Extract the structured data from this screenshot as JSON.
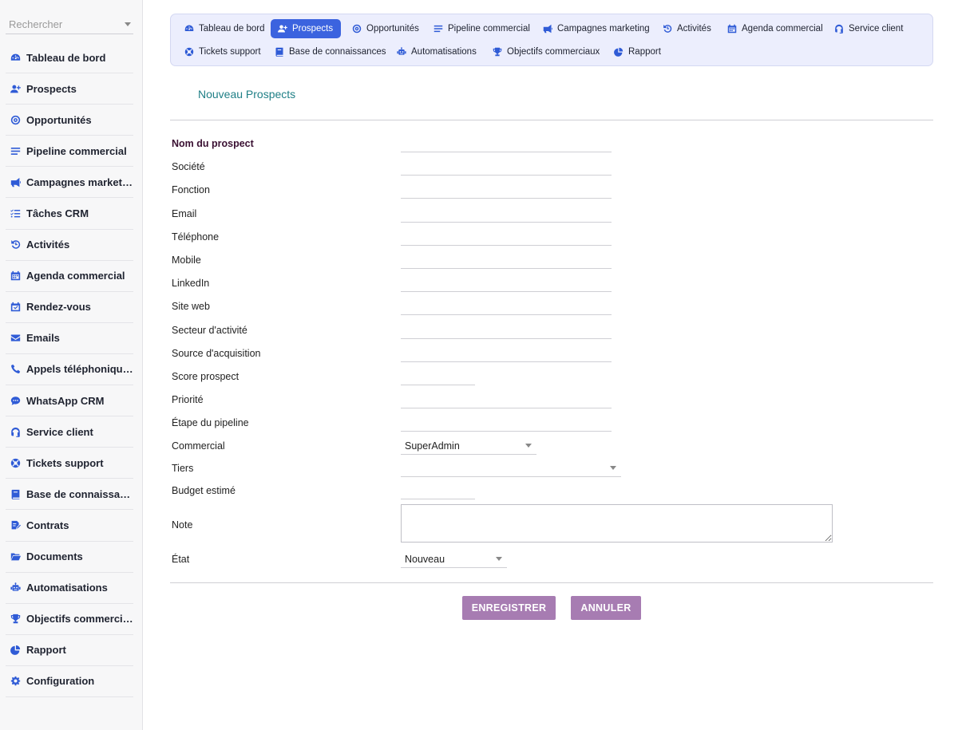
{
  "search": {
    "placeholder": "Rechercher"
  },
  "sidebar": {
    "items": [
      {
        "label": "Tableau de bord",
        "icon": "dashboard-icon"
      },
      {
        "label": "Prospects",
        "icon": "user-plus-icon"
      },
      {
        "label": "Opportunités",
        "icon": "target-icon"
      },
      {
        "label": "Pipeline commercial",
        "icon": "bars-icon"
      },
      {
        "label": "Campagnes marketing",
        "icon": "megaphone-icon"
      },
      {
        "label": "Tâches CRM",
        "icon": "tasks-icon"
      },
      {
        "label": "Activités",
        "icon": "history-icon"
      },
      {
        "label": "Agenda commercial",
        "icon": "calendar-icon"
      },
      {
        "label": "Rendez-vous",
        "icon": "calendar-check-icon"
      },
      {
        "label": "Emails",
        "icon": "envelope-icon"
      },
      {
        "label": "Appels téléphoniques",
        "icon": "phone-icon"
      },
      {
        "label": "WhatsApp CRM",
        "icon": "chat-icon"
      },
      {
        "label": "Service client",
        "icon": "headset-icon"
      },
      {
        "label": "Tickets support",
        "icon": "lifering-icon"
      },
      {
        "label": "Base de connaissances",
        "icon": "book-icon"
      },
      {
        "label": "Contrats",
        "icon": "contract-icon"
      },
      {
        "label": "Documents",
        "icon": "folder-icon"
      },
      {
        "label": "Automatisations",
        "icon": "robot-icon"
      },
      {
        "label": "Objectifs commerciaux",
        "icon": "trophy-icon"
      },
      {
        "label": "Rapport",
        "icon": "pie-icon"
      },
      {
        "label": "Configuration",
        "icon": "gear-icon"
      }
    ]
  },
  "topnav": {
    "tabs": [
      {
        "label": "Tableau de bord",
        "icon": "dashboard-icon",
        "active": false
      },
      {
        "label": "Prospects",
        "icon": "user-plus-icon",
        "active": true
      },
      {
        "label": "Opportunités",
        "icon": "target-icon",
        "active": false
      },
      {
        "label": "Pipeline commercial",
        "icon": "bars-icon",
        "active": false
      },
      {
        "label": "Campagnes marketing",
        "icon": "megaphone-icon",
        "active": false
      },
      {
        "label": "Activités",
        "icon": "history-icon",
        "active": false
      },
      {
        "label": "Agenda commercial",
        "icon": "calendar-icon",
        "active": false
      },
      {
        "label": "Service client",
        "icon": "headset-icon",
        "active": false
      },
      {
        "label": "Tickets support",
        "icon": "lifering-icon",
        "active": false
      },
      {
        "label": "Base de connaissances",
        "icon": "book-icon",
        "active": false
      },
      {
        "label": "Automatisations",
        "icon": "robot-icon",
        "active": false
      },
      {
        "label": "Objectifs commerciaux",
        "icon": "trophy-icon",
        "active": false
      },
      {
        "label": "Rapport",
        "icon": "pie-icon",
        "active": false
      }
    ]
  },
  "form": {
    "title": "Nouveau Prospects",
    "fields": [
      {
        "label": "Nom du prospect",
        "value": ""
      },
      {
        "label": "Société",
        "value": ""
      },
      {
        "label": "Fonction",
        "value": ""
      },
      {
        "label": "Email",
        "value": ""
      },
      {
        "label": "Téléphone",
        "value": ""
      },
      {
        "label": "Mobile",
        "value": ""
      },
      {
        "label": "LinkedIn",
        "value": ""
      },
      {
        "label": "Site web",
        "value": ""
      },
      {
        "label": "Secteur d'activité",
        "value": ""
      },
      {
        "label": "Source d'acquisition",
        "value": ""
      },
      {
        "label": "Score prospect",
        "value": ""
      },
      {
        "label": "Priorité",
        "value": ""
      },
      {
        "label": "Étape du pipeline",
        "value": ""
      }
    ],
    "commercial": {
      "label": "Commercial",
      "value": "SuperAdmin"
    },
    "tiers": {
      "label": "Tiers",
      "value": ""
    },
    "budget": {
      "label": "Budget estimé",
      "value": ""
    },
    "note": {
      "label": "Note",
      "value": ""
    },
    "etat": {
      "label": "État",
      "value": "Nouveau"
    },
    "save_label": "ENREGISTRER",
    "cancel_label": "ANNULER"
  },
  "colors": {
    "accent": "#3b63df",
    "button": "#a77cb2",
    "title": "#1f7f86",
    "required_label": "#3b1133"
  }
}
